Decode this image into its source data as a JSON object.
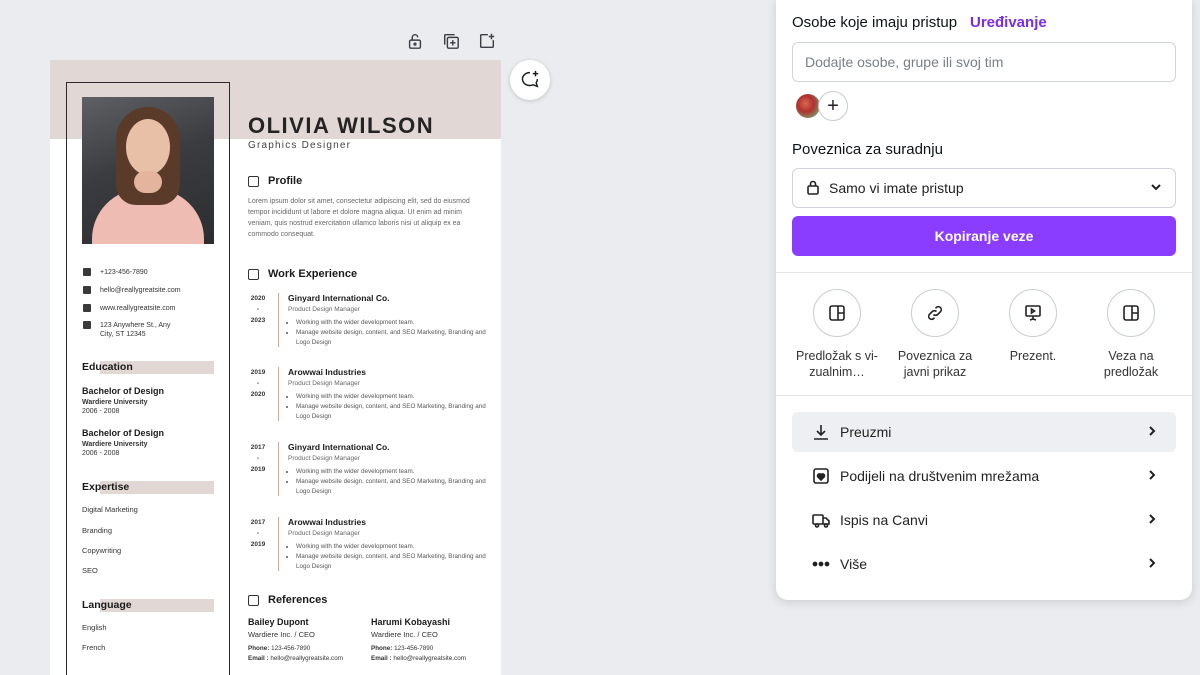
{
  "panel": {
    "people_title": "Osobe koje imaju pristup",
    "edit_label": "Uređivanje",
    "people_placeholder": "Dodajte osobe, grupe ili svoj tim",
    "add_symbol": "+",
    "link_title": "Poveznica za suradnju",
    "access_value": "Samo vi imate pristup",
    "copy_button": "Kopiranje veze",
    "options": [
      {
        "label": "Predložak s vi-zualnim…",
        "icon": "template-layout-icon"
      },
      {
        "label": "Poveznica za javni prikaz",
        "icon": "link-icon"
      },
      {
        "label": "Prezent.",
        "icon": "presentation-icon"
      },
      {
        "label": "Veza na predložak",
        "icon": "template-link-icon"
      }
    ],
    "actions": [
      {
        "label": "Preuzmi",
        "icon": "download-icon"
      },
      {
        "label": "Podijeli na društvenim mrežama",
        "icon": "social-heart-icon"
      },
      {
        "label": "Ispis na Canvi",
        "icon": "delivery-truck-icon"
      },
      {
        "label": "Više",
        "icon": "more-dots-icon"
      }
    ]
  },
  "resume": {
    "name": "OLIVIA WILSON",
    "role": "Graphics Designer",
    "contact": {
      "phone": "+123-456-7890",
      "email": "hello@reallygreatsite.com",
      "web": "www.reallygreatsite.com",
      "address": "123 Anywhere St., Any City, ST 12345"
    },
    "education_title": "Education",
    "education": [
      {
        "degree": "Bachelor of Design",
        "school": "Wardiere University",
        "years": "2006 - 2008"
      },
      {
        "degree": "Bachelor of Design",
        "school": "Wardiere University",
        "years": "2006 - 2008"
      }
    ],
    "expertise_title": "Expertise",
    "expertise": [
      "Digital Marketing",
      "Branding",
      "Copywriting",
      "SEO"
    ],
    "language_title": "Language",
    "languages": [
      "English",
      "French"
    ],
    "profile_title": "Profile",
    "profile_text": "Lorem ipsum dolor sit amet, consectetur adipiscing elit, sed do eiusmod tempor incididunt ut labore et dolore magna aliqua. Ut enim ad minim veniam, quis nostrud exercitation ullamco laboris nisi ut aliquip ex ea commodo consequat.",
    "work_title": "Work Experience",
    "jobs": [
      {
        "y1": "2020",
        "dash": "-",
        "y2": "2023",
        "company": "Ginyard International Co.",
        "position": "Product Design Manager",
        "b1": "Working with the wider development team.",
        "b2": "Manage website design, content, and SEO Marketing, Branding and Logo Design"
      },
      {
        "y1": "2019",
        "dash": "-",
        "y2": "2020",
        "company": "Arowwai Industries",
        "position": "Product Design Manager",
        "b1": "Working with the wider development team.",
        "b2": "Manage website design, content, and SEO Marketing, Branding and Logo Design"
      },
      {
        "y1": "2017",
        "dash": "-",
        "y2": "2019",
        "company": "Ginyard International Co.",
        "position": "Product Design Manager",
        "b1": "Working with the wider development team.",
        "b2": "Manage website design, content, and SEO Marketing, Branding and Logo Design"
      },
      {
        "y1": "2017",
        "dash": "-",
        "y2": "2019",
        "company": "Arowwai Industries",
        "position": "Product Design Manager",
        "b1": "Working with the wider development team.",
        "b2": "Manage website design, content, and SEO Marketing, Branding and Logo Design"
      }
    ],
    "references_title": "References",
    "references": [
      {
        "name": "Bailey Dupont",
        "role": "Wardiere Inc. / CEO",
        "phone_label": "Phone:",
        "phone": "123-456-7890",
        "email_label": "Email :",
        "email": "hello@reallygreatsite.com"
      },
      {
        "name": "Harumi Kobayashi",
        "role": "Wardiere Inc. / CEO",
        "phone_label": "Phone:",
        "phone": "123-456-7890",
        "email_label": "Email :",
        "email": "hello@reallygreatsite.com"
      }
    ]
  },
  "colors": {
    "accent": "#8b3dff",
    "edit_link": "#7d2ae8",
    "resume_band": "#e1d7d4",
    "timeline": "#d7a48f"
  }
}
